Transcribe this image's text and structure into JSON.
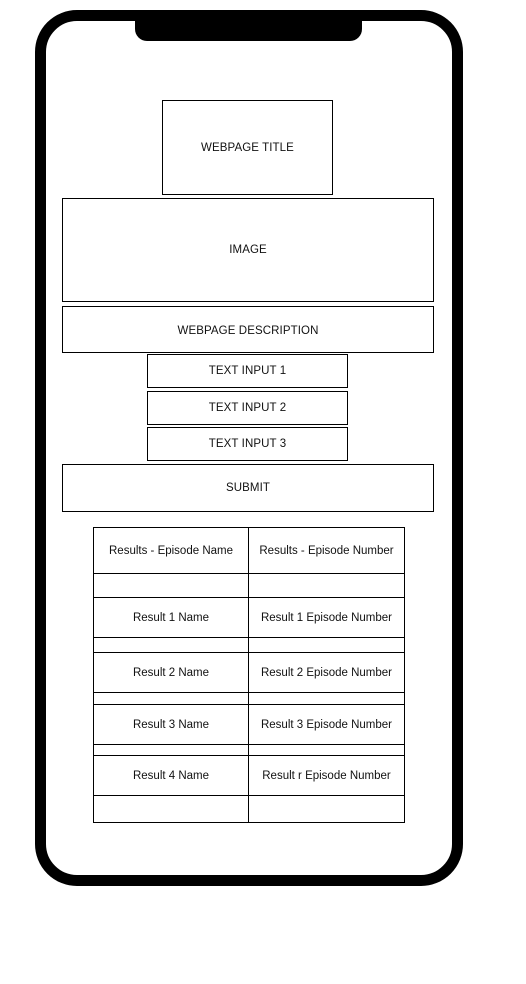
{
  "header": {
    "title": "WEBPAGE TITLE"
  },
  "image": {
    "label": "IMAGE"
  },
  "description": {
    "label": "WEBPAGE DESCRIPTION"
  },
  "form": {
    "inputs": [
      {
        "label": "TEXT INPUT 1"
      },
      {
        "label": "TEXT INPUT 2"
      },
      {
        "label": "TEXT INPUT 3"
      }
    ],
    "submit_label": "SUBMIT"
  },
  "results": {
    "columns": [
      "Results - Episode Name",
      "Results - Episode Number"
    ],
    "rows": [
      {
        "name": "Result 1 Name",
        "number": "Result 1 Episode Number"
      },
      {
        "name": "Result 2 Name",
        "number": "Result 2 Episode Number"
      },
      {
        "name": "Result 3 Name",
        "number": "Result 3 Episode Number"
      },
      {
        "name": "Result 4 Name",
        "number": "Result r Episode Number"
      }
    ]
  }
}
